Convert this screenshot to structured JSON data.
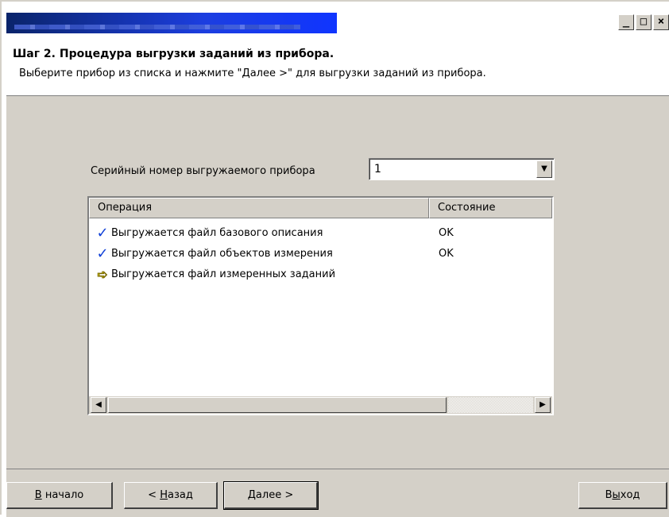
{
  "window": {
    "buttons": {
      "minimize": "_",
      "maximize": "□",
      "close": "×"
    }
  },
  "header": {
    "title": "Шаг 2. Процедура выгрузки заданий из прибора.",
    "subtitle": "Выберите прибор из списка и нажмите \"Далее >\" для выгрузки заданий из прибора."
  },
  "serial": {
    "label": "Серийный номер выгружаемого прибора",
    "value": "1"
  },
  "table": {
    "columns": [
      "Операция",
      "Состояние"
    ],
    "rows": [
      {
        "icon": "checkmark-icon",
        "operation": "Выгружается файл базового описания",
        "status": "OK"
      },
      {
        "icon": "checkmark-icon",
        "operation": "Выгружается файл объектов измерения",
        "status": "OK"
      },
      {
        "icon": "yellow-arrow-icon",
        "operation": "Выгружается файл измеренных заданий",
        "status": ""
      }
    ]
  },
  "footer": {
    "start_prefix": "В",
    "start_rest": " начало",
    "back_prefix": "< ",
    "back_ul": "Н",
    "back_rest": "азад",
    "next_ul": "Д",
    "next_rest": "алее >",
    "exit_a": "В",
    "exit_ul": "ы",
    "exit_b": "ход"
  },
  "colors": {
    "titlebar_start": "#0a246a",
    "titlebar_end": "#1035ff",
    "dialog_face": "#d4d0c8",
    "check": "#1040d8",
    "arrow": "#f0e000"
  }
}
